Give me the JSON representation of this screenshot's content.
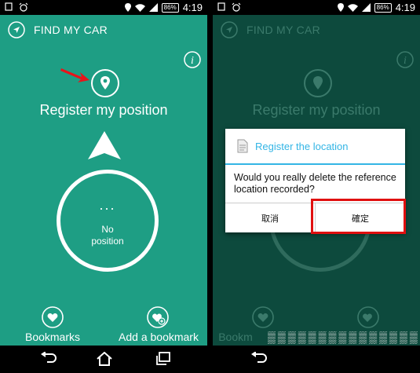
{
  "status_bar": {
    "time": "4:19",
    "battery": "86%"
  },
  "app": {
    "title": "FIND MY CAR"
  },
  "register": {
    "label": "Register my position"
  },
  "compass": {
    "dots": "...",
    "text_line1": "No",
    "text_line2": "position"
  },
  "bottom": {
    "bookmarks_label": "Bookmarks",
    "add_bookmark_label": "Add a bookmark"
  },
  "dim_bottom": {
    "bookmarks_label": "Bookm"
  },
  "dialog": {
    "title": "Register the location",
    "message": "Would you really delete the reference location recorded?",
    "cancel_label": "取消",
    "ok_label": "確定"
  },
  "colors": {
    "primary": "#1e9e84",
    "dim": "#0d4a3d",
    "accent": "#33b5e5",
    "highlight": "#e01010",
    "annotation_arrow": "#e8141a"
  }
}
